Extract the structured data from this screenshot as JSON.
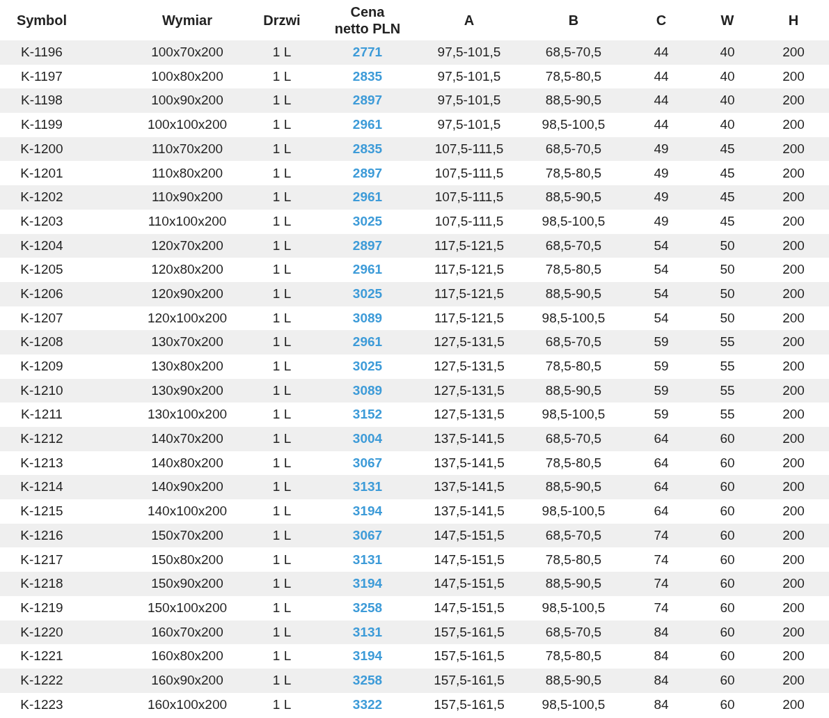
{
  "table": {
    "columns": [
      {
        "label": "Symbol",
        "kind": "plain"
      },
      {
        "label": "Wymiar",
        "kind": "plain"
      },
      {
        "label": "Drzwi",
        "kind": "plain"
      },
      {
        "label": "Cena netto PLN",
        "kind": "price"
      },
      {
        "label": "A",
        "kind": "plain"
      },
      {
        "label": "B",
        "kind": "plain"
      },
      {
        "label": "C",
        "kind": "plain"
      },
      {
        "label": "W",
        "kind": "plain"
      },
      {
        "label": "H",
        "kind": "plain"
      }
    ],
    "rows": [
      [
        "K-1196",
        "100x70x200",
        "1 L",
        "2771",
        "97,5-101,5",
        "68,5-70,5",
        "44",
        "40",
        "200"
      ],
      [
        "K-1197",
        "100x80x200",
        "1 L",
        "2835",
        "97,5-101,5",
        "78,5-80,5",
        "44",
        "40",
        "200"
      ],
      [
        "K-1198",
        "100x90x200",
        "1 L",
        "2897",
        "97,5-101,5",
        "88,5-90,5",
        "44",
        "40",
        "200"
      ],
      [
        "K-1199",
        "100x100x200",
        "1 L",
        "2961",
        "97,5-101,5",
        "98,5-100,5",
        "44",
        "40",
        "200"
      ],
      [
        "K-1200",
        "110x70x200",
        "1 L",
        "2835",
        "107,5-111,5",
        "68,5-70,5",
        "49",
        "45",
        "200"
      ],
      [
        "K-1201",
        "110x80x200",
        "1 L",
        "2897",
        "107,5-111,5",
        "78,5-80,5",
        "49",
        "45",
        "200"
      ],
      [
        "K-1202",
        "110x90x200",
        "1 L",
        "2961",
        "107,5-111,5",
        "88,5-90,5",
        "49",
        "45",
        "200"
      ],
      [
        "K-1203",
        "110x100x200",
        "1 L",
        "3025",
        "107,5-111,5",
        "98,5-100,5",
        "49",
        "45",
        "200"
      ],
      [
        "K-1204",
        "120x70x200",
        "1 L",
        "2897",
        "117,5-121,5",
        "68,5-70,5",
        "54",
        "50",
        "200"
      ],
      [
        "K-1205",
        "120x80x200",
        "1 L",
        "2961",
        "117,5-121,5",
        "78,5-80,5",
        "54",
        "50",
        "200"
      ],
      [
        "K-1206",
        "120x90x200",
        "1 L",
        "3025",
        "117,5-121,5",
        "88,5-90,5",
        "54",
        "50",
        "200"
      ],
      [
        "K-1207",
        "120x100x200",
        "1 L",
        "3089",
        "117,5-121,5",
        "98,5-100,5",
        "54",
        "50",
        "200"
      ],
      [
        "K-1208",
        "130x70x200",
        "1 L",
        "2961",
        "127,5-131,5",
        "68,5-70,5",
        "59",
        "55",
        "200"
      ],
      [
        "K-1209",
        "130x80x200",
        "1 L",
        "3025",
        "127,5-131,5",
        "78,5-80,5",
        "59",
        "55",
        "200"
      ],
      [
        "K-1210",
        "130x90x200",
        "1 L",
        "3089",
        "127,5-131,5",
        "88,5-90,5",
        "59",
        "55",
        "200"
      ],
      [
        "K-1211",
        "130x100x200",
        "1 L",
        "3152",
        "127,5-131,5",
        "98,5-100,5",
        "59",
        "55",
        "200"
      ],
      [
        "K-1212",
        "140x70x200",
        "1 L",
        "3004",
        "137,5-141,5",
        "68,5-70,5",
        "64",
        "60",
        "200"
      ],
      [
        "K-1213",
        "140x80x200",
        "1 L",
        "3067",
        "137,5-141,5",
        "78,5-80,5",
        "64",
        "60",
        "200"
      ],
      [
        "K-1214",
        "140x90x200",
        "1 L",
        "3131",
        "137,5-141,5",
        "88,5-90,5",
        "64",
        "60",
        "200"
      ],
      [
        "K-1215",
        "140x100x200",
        "1 L",
        "3194",
        "137,5-141,5",
        "98,5-100,5",
        "64",
        "60",
        "200"
      ],
      [
        "K-1216",
        "150x70x200",
        "1 L",
        "3067",
        "147,5-151,5",
        "68,5-70,5",
        "74",
        "60",
        "200"
      ],
      [
        "K-1217",
        "150x80x200",
        "1 L",
        "3131",
        "147,5-151,5",
        "78,5-80,5",
        "74",
        "60",
        "200"
      ],
      [
        "K-1218",
        "150x90x200",
        "1 L",
        "3194",
        "147,5-151,5",
        "88,5-90,5",
        "74",
        "60",
        "200"
      ],
      [
        "K-1219",
        "150x100x200",
        "1 L",
        "3258",
        "147,5-151,5",
        "98,5-100,5",
        "74",
        "60",
        "200"
      ],
      [
        "K-1220",
        "160x70x200",
        "1 L",
        "3131",
        "157,5-161,5",
        "68,5-70,5",
        "84",
        "60",
        "200"
      ],
      [
        "K-1221",
        "160x80x200",
        "1 L",
        "3194",
        "157,5-161,5",
        "78,5-80,5",
        "84",
        "60",
        "200"
      ],
      [
        "K-1222",
        "160x90x200",
        "1 L",
        "3258",
        "157,5-161,5",
        "88,5-90,5",
        "84",
        "60",
        "200"
      ],
      [
        "K-1223",
        "160x100x200",
        "1 L",
        "3322",
        "157,5-161,5",
        "98,5-100,5",
        "84",
        "60",
        "200"
      ]
    ]
  }
}
